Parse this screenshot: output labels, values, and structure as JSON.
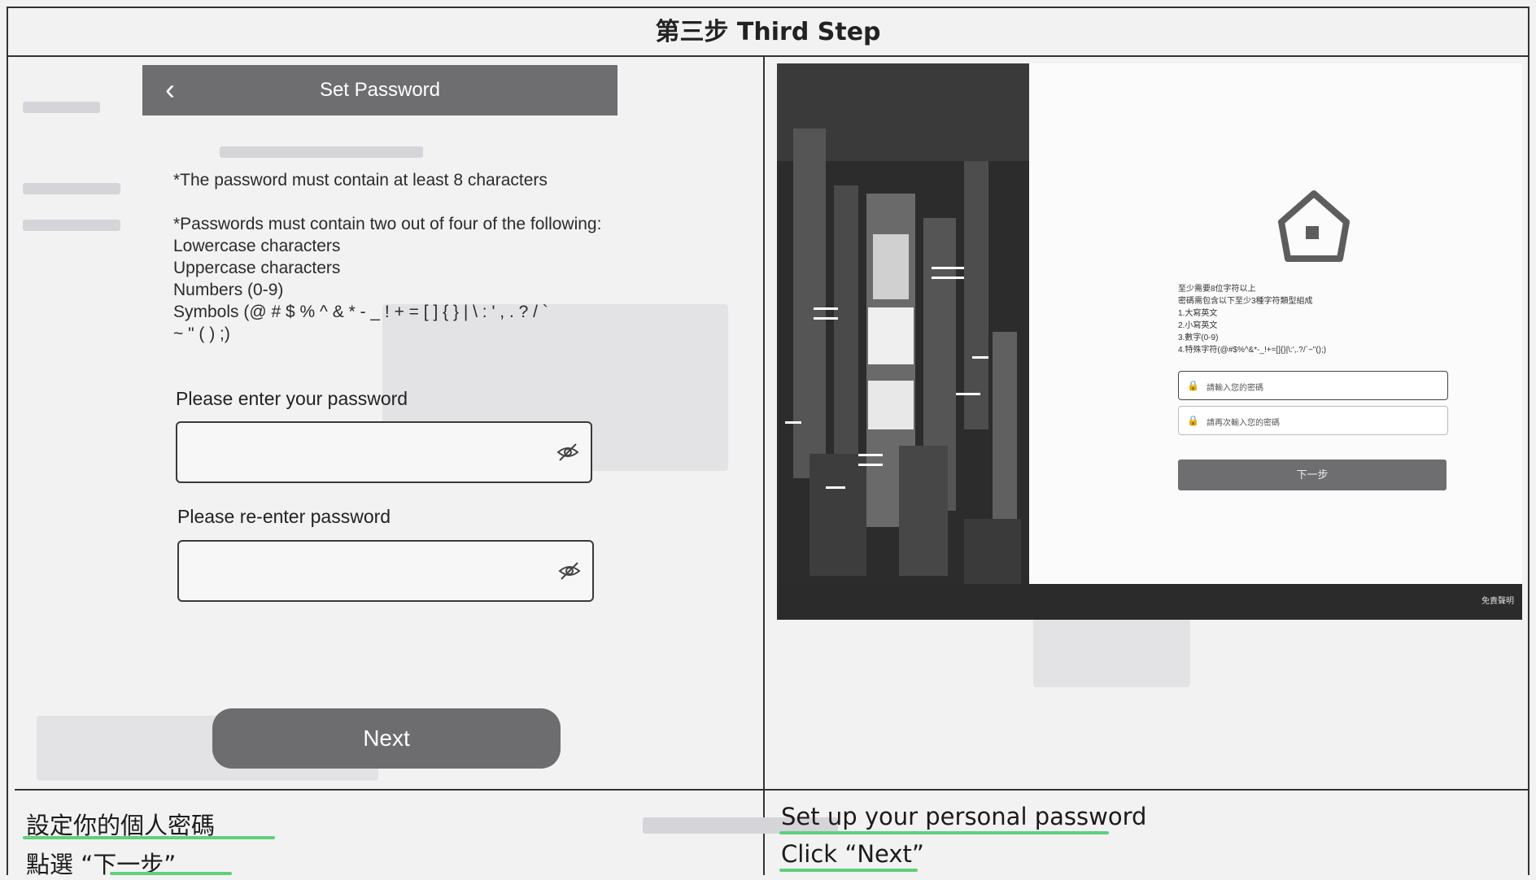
{
  "header": {
    "title": "第三步  Third Step"
  },
  "left_panel": {
    "appbar": {
      "back_icon": "chevron-left-icon",
      "title": "Set Password"
    },
    "rules": [
      "*The password must contain at least 8 characters",
      "*Passwords must contain two out of four of the following:",
      "Lowercase characters",
      "Uppercase characters",
      "Numbers (0-9)",
      "Symbols (@ # $ % ^ & * - _ ! + = [ ] { } | \\ : ' , . ? / `",
      "~ \" ( ) ;)"
    ],
    "password_label": "Please enter your password",
    "reenter_label": "Please re-enter password",
    "next_label": "Next"
  },
  "right_panel": {
    "rules": [
      "至少需要8位字符以上",
      "密碼需包含以下至少3種字符類型組成",
      "1.大寫英文",
      "2.小寫英文",
      "3.數字(0-9)",
      "4.特殊字符(@#$%^&*-_!+=[]{}|\\:',.?/`~\"();)"
    ],
    "password_placeholder": "請輸入您的密碼",
    "reenter_placeholder": "請再次輸入您的密碼",
    "next_label": "下一步",
    "footer_text": "免責聲明"
  },
  "captions": {
    "left_line1": "設定你的個人密碼",
    "left_line2": "點選  “下一步”",
    "right_line1": "Set up your personal password",
    "right_line2": "Click “Next”"
  }
}
